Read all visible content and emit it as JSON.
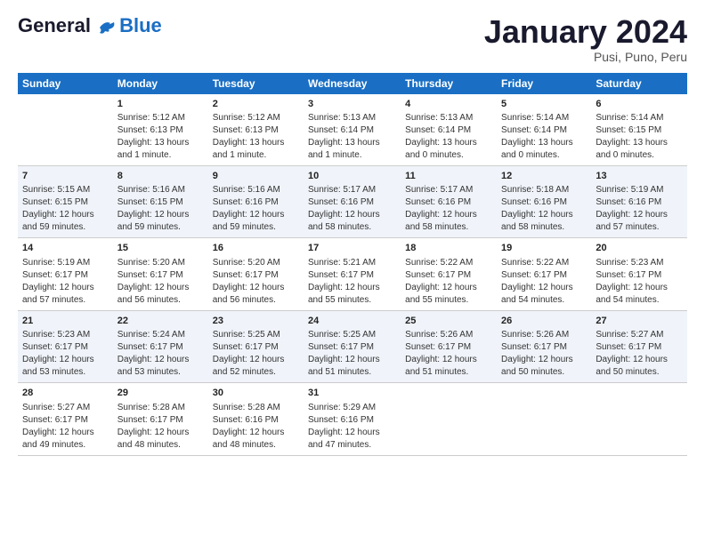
{
  "header": {
    "logo_line1": "General",
    "logo_line2": "Blue",
    "month": "January 2024",
    "location": "Pusi, Puno, Peru"
  },
  "days_of_week": [
    "Sunday",
    "Monday",
    "Tuesday",
    "Wednesday",
    "Thursday",
    "Friday",
    "Saturday"
  ],
  "weeks": [
    [
      {
        "day": "",
        "sunrise": "",
        "sunset": "",
        "daylight": ""
      },
      {
        "day": "1",
        "sunrise": "Sunrise: 5:12 AM",
        "sunset": "Sunset: 6:13 PM",
        "daylight": "Daylight: 13 hours and 1 minute."
      },
      {
        "day": "2",
        "sunrise": "Sunrise: 5:12 AM",
        "sunset": "Sunset: 6:13 PM",
        "daylight": "Daylight: 13 hours and 1 minute."
      },
      {
        "day": "3",
        "sunrise": "Sunrise: 5:13 AM",
        "sunset": "Sunset: 6:14 PM",
        "daylight": "Daylight: 13 hours and 1 minute."
      },
      {
        "day": "4",
        "sunrise": "Sunrise: 5:13 AM",
        "sunset": "Sunset: 6:14 PM",
        "daylight": "Daylight: 13 hours and 0 minutes."
      },
      {
        "day": "5",
        "sunrise": "Sunrise: 5:14 AM",
        "sunset": "Sunset: 6:14 PM",
        "daylight": "Daylight: 13 hours and 0 minutes."
      },
      {
        "day": "6",
        "sunrise": "Sunrise: 5:14 AM",
        "sunset": "Sunset: 6:15 PM",
        "daylight": "Daylight: 13 hours and 0 minutes."
      }
    ],
    [
      {
        "day": "7",
        "sunrise": "Sunrise: 5:15 AM",
        "sunset": "Sunset: 6:15 PM",
        "daylight": "Daylight: 12 hours and 59 minutes."
      },
      {
        "day": "8",
        "sunrise": "Sunrise: 5:16 AM",
        "sunset": "Sunset: 6:15 PM",
        "daylight": "Daylight: 12 hours and 59 minutes."
      },
      {
        "day": "9",
        "sunrise": "Sunrise: 5:16 AM",
        "sunset": "Sunset: 6:16 PM",
        "daylight": "Daylight: 12 hours and 59 minutes."
      },
      {
        "day": "10",
        "sunrise": "Sunrise: 5:17 AM",
        "sunset": "Sunset: 6:16 PM",
        "daylight": "Daylight: 12 hours and 58 minutes."
      },
      {
        "day": "11",
        "sunrise": "Sunrise: 5:17 AM",
        "sunset": "Sunset: 6:16 PM",
        "daylight": "Daylight: 12 hours and 58 minutes."
      },
      {
        "day": "12",
        "sunrise": "Sunrise: 5:18 AM",
        "sunset": "Sunset: 6:16 PM",
        "daylight": "Daylight: 12 hours and 58 minutes."
      },
      {
        "day": "13",
        "sunrise": "Sunrise: 5:19 AM",
        "sunset": "Sunset: 6:16 PM",
        "daylight": "Daylight: 12 hours and 57 minutes."
      }
    ],
    [
      {
        "day": "14",
        "sunrise": "Sunrise: 5:19 AM",
        "sunset": "Sunset: 6:17 PM",
        "daylight": "Daylight: 12 hours and 57 minutes."
      },
      {
        "day": "15",
        "sunrise": "Sunrise: 5:20 AM",
        "sunset": "Sunset: 6:17 PM",
        "daylight": "Daylight: 12 hours and 56 minutes."
      },
      {
        "day": "16",
        "sunrise": "Sunrise: 5:20 AM",
        "sunset": "Sunset: 6:17 PM",
        "daylight": "Daylight: 12 hours and 56 minutes."
      },
      {
        "day": "17",
        "sunrise": "Sunrise: 5:21 AM",
        "sunset": "Sunset: 6:17 PM",
        "daylight": "Daylight: 12 hours and 55 minutes."
      },
      {
        "day": "18",
        "sunrise": "Sunrise: 5:22 AM",
        "sunset": "Sunset: 6:17 PM",
        "daylight": "Daylight: 12 hours and 55 minutes."
      },
      {
        "day": "19",
        "sunrise": "Sunrise: 5:22 AM",
        "sunset": "Sunset: 6:17 PM",
        "daylight": "Daylight: 12 hours and 54 minutes."
      },
      {
        "day": "20",
        "sunrise": "Sunrise: 5:23 AM",
        "sunset": "Sunset: 6:17 PM",
        "daylight": "Daylight: 12 hours and 54 minutes."
      }
    ],
    [
      {
        "day": "21",
        "sunrise": "Sunrise: 5:23 AM",
        "sunset": "Sunset: 6:17 PM",
        "daylight": "Daylight: 12 hours and 53 minutes."
      },
      {
        "day": "22",
        "sunrise": "Sunrise: 5:24 AM",
        "sunset": "Sunset: 6:17 PM",
        "daylight": "Daylight: 12 hours and 53 minutes."
      },
      {
        "day": "23",
        "sunrise": "Sunrise: 5:25 AM",
        "sunset": "Sunset: 6:17 PM",
        "daylight": "Daylight: 12 hours and 52 minutes."
      },
      {
        "day": "24",
        "sunrise": "Sunrise: 5:25 AM",
        "sunset": "Sunset: 6:17 PM",
        "daylight": "Daylight: 12 hours and 51 minutes."
      },
      {
        "day": "25",
        "sunrise": "Sunrise: 5:26 AM",
        "sunset": "Sunset: 6:17 PM",
        "daylight": "Daylight: 12 hours and 51 minutes."
      },
      {
        "day": "26",
        "sunrise": "Sunrise: 5:26 AM",
        "sunset": "Sunset: 6:17 PM",
        "daylight": "Daylight: 12 hours and 50 minutes."
      },
      {
        "day": "27",
        "sunrise": "Sunrise: 5:27 AM",
        "sunset": "Sunset: 6:17 PM",
        "daylight": "Daylight: 12 hours and 50 minutes."
      }
    ],
    [
      {
        "day": "28",
        "sunrise": "Sunrise: 5:27 AM",
        "sunset": "Sunset: 6:17 PM",
        "daylight": "Daylight: 12 hours and 49 minutes."
      },
      {
        "day": "29",
        "sunrise": "Sunrise: 5:28 AM",
        "sunset": "Sunset: 6:17 PM",
        "daylight": "Daylight: 12 hours and 48 minutes."
      },
      {
        "day": "30",
        "sunrise": "Sunrise: 5:28 AM",
        "sunset": "Sunset: 6:16 PM",
        "daylight": "Daylight: 12 hours and 48 minutes."
      },
      {
        "day": "31",
        "sunrise": "Sunrise: 5:29 AM",
        "sunset": "Sunset: 6:16 PM",
        "daylight": "Daylight: 12 hours and 47 minutes."
      },
      {
        "day": "",
        "sunrise": "",
        "sunset": "",
        "daylight": ""
      },
      {
        "day": "",
        "sunrise": "",
        "sunset": "",
        "daylight": ""
      },
      {
        "day": "",
        "sunrise": "",
        "sunset": "",
        "daylight": ""
      }
    ]
  ]
}
